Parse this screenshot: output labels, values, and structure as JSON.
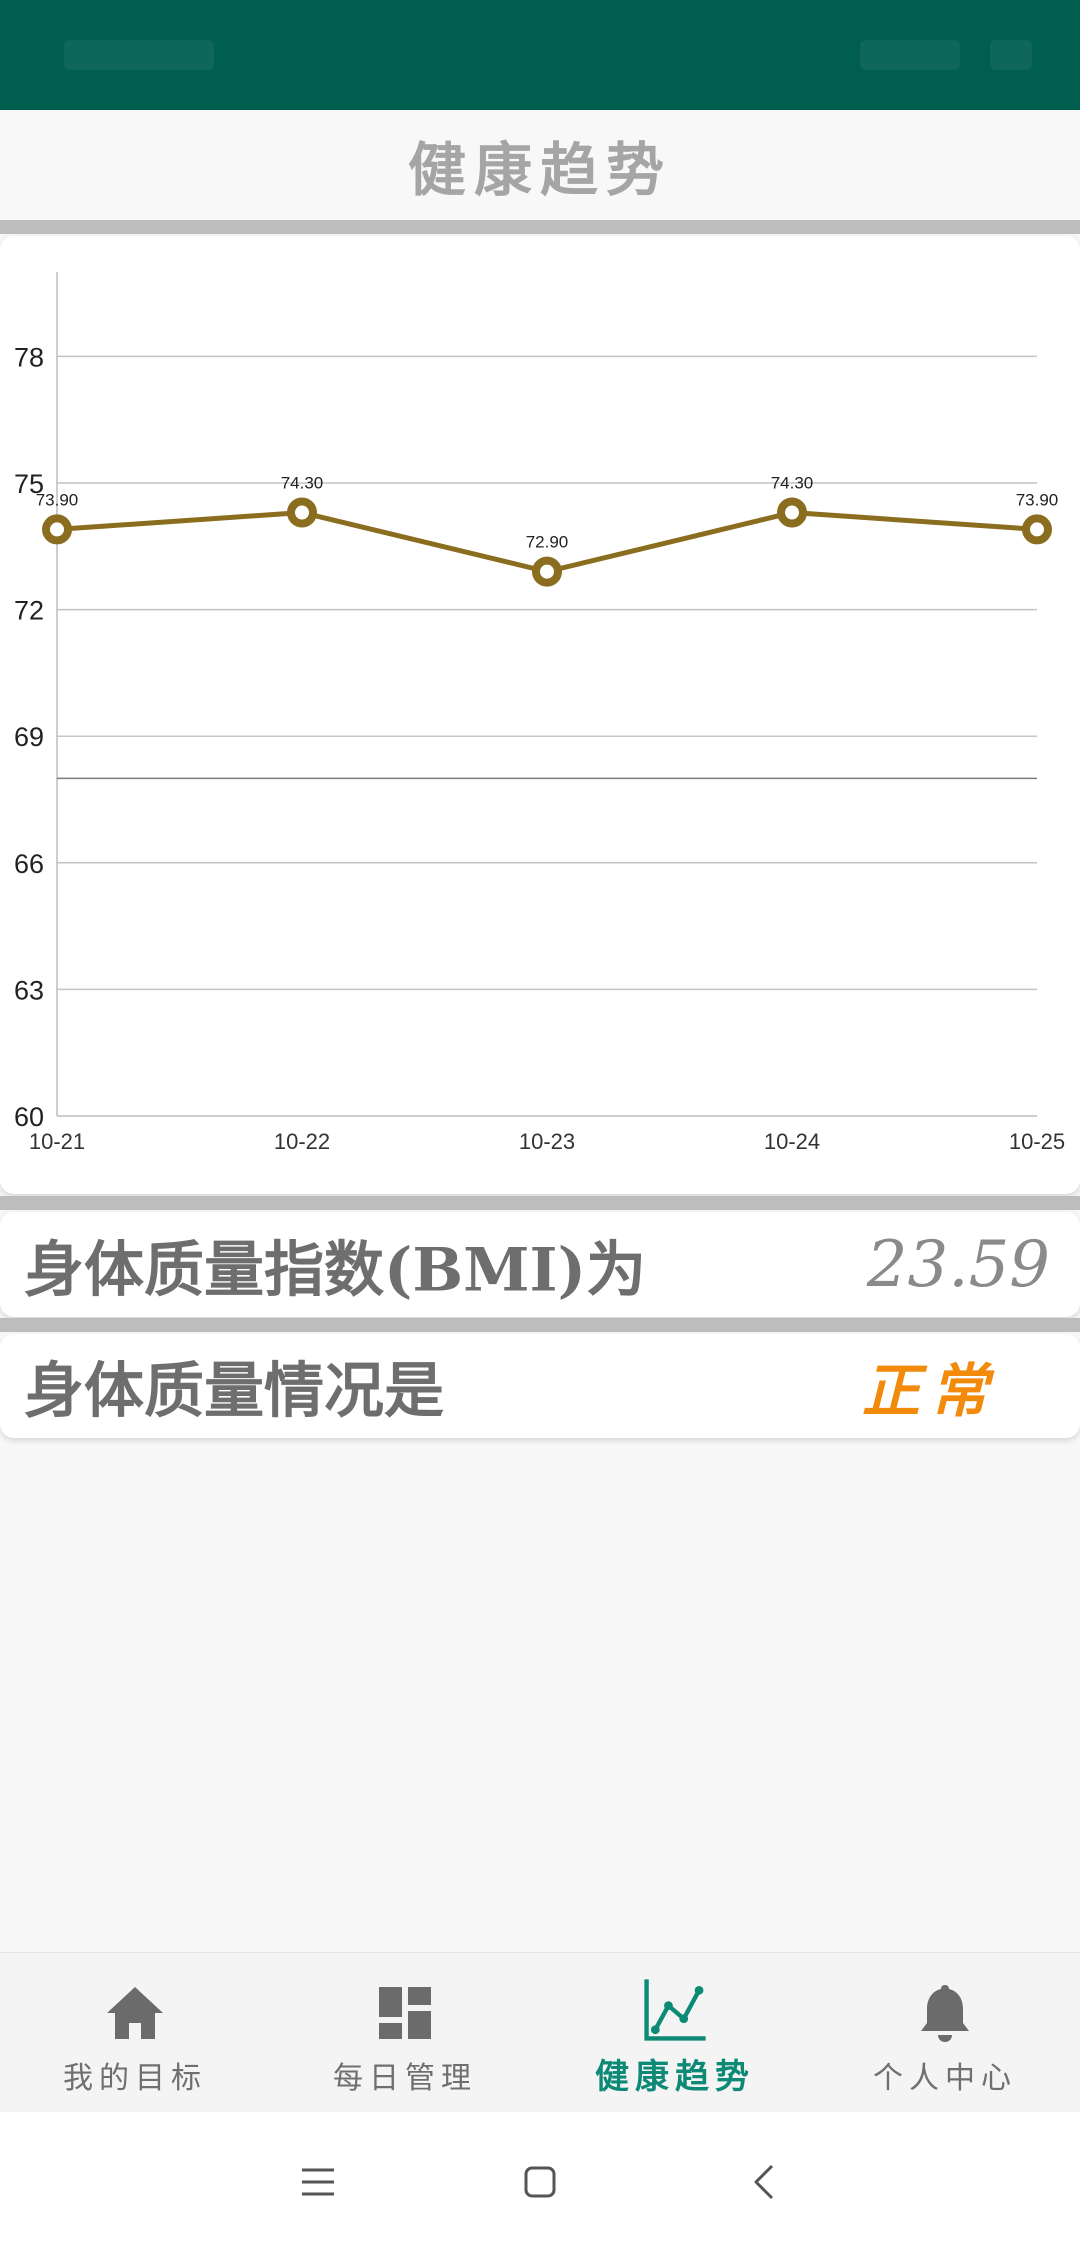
{
  "page": {
    "title": "健康趋势"
  },
  "chart_data": {
    "type": "line",
    "x": [
      "10-21",
      "10-22",
      "10-23",
      "10-24",
      "10-25"
    ],
    "series": [
      {
        "values": [
          73.9,
          74.3,
          72.9,
          74.3,
          73.9
        ],
        "labels": [
          "73.90",
          "74.30",
          "72.90",
          "74.30",
          "73.90"
        ],
        "color": "#8a6d1e"
      }
    ],
    "yticks": [
      "60",
      "63",
      "66",
      "69",
      "72",
      "75",
      "78"
    ],
    "ylim": [
      60,
      80
    ],
    "limit_line": 68,
    "grid": true
  },
  "bmi": {
    "label": "身体质量指数(BMI)为",
    "value": "23.59"
  },
  "body_status": {
    "label": "身体质量情况是",
    "value": "正常",
    "color": "#f28a0c"
  },
  "bottom_nav": {
    "items": [
      {
        "label": "我的目标",
        "icon": "home-icon"
      },
      {
        "label": "每日管理",
        "icon": "dashboard-icon"
      },
      {
        "label": "健康趋势",
        "icon": "trend-chart-icon",
        "active": true
      },
      {
        "label": "个人中心",
        "icon": "bell-icon"
      }
    ],
    "active_color": "#0d8a76"
  },
  "system_nav": {
    "icons": [
      "menu-icon",
      "home-square-icon",
      "back-icon"
    ]
  },
  "colors": {
    "status_bar": "#005e4f",
    "line": "#8a6d1e"
  }
}
